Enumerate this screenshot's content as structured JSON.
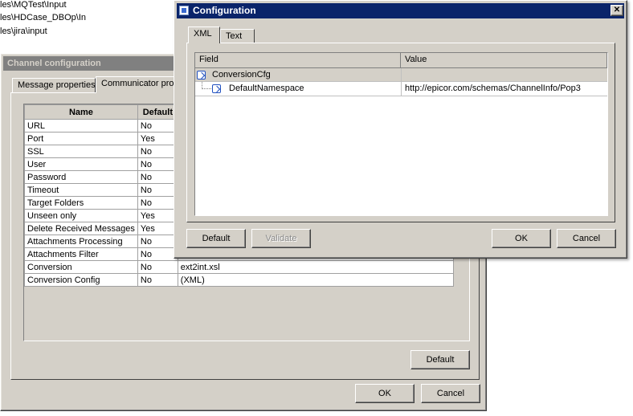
{
  "background_paths": [
    "les\\MQTest\\Input",
    "les\\HDCase_DBOp\\In",
    "les\\jira\\input"
  ],
  "channel_window": {
    "title": "Channel configuration",
    "tabs": [
      "Message properties",
      "Communicator prop"
    ],
    "columns": {
      "name": "Name",
      "default": "Default"
    },
    "rows": [
      {
        "name": "URL",
        "default": "No",
        "value": ""
      },
      {
        "name": "Port",
        "default": "Yes",
        "value": ""
      },
      {
        "name": "SSL",
        "default": "No",
        "value": ""
      },
      {
        "name": "User",
        "default": "No",
        "value": ""
      },
      {
        "name": "Password",
        "default": "No",
        "value": ""
      },
      {
        "name": "Timeout",
        "default": "No",
        "value": ""
      },
      {
        "name": "Target Folders",
        "default": "No",
        "value": ""
      },
      {
        "name": "Unseen only",
        "default": "Yes",
        "value": ""
      },
      {
        "name": "Delete Received Messages",
        "default": "Yes",
        "value": ""
      },
      {
        "name": "Attachments Processing",
        "default": "No",
        "value": ""
      },
      {
        "name": "Attachments Filter",
        "default": "No",
        "value": ""
      },
      {
        "name": "Conversion",
        "default": "No",
        "value": "ext2int.xsl"
      },
      {
        "name": "Conversion Config",
        "default": "No",
        "value": "(XML)"
      }
    ],
    "default_button": "Default",
    "ok_button": "OK",
    "cancel_button": "Cancel"
  },
  "config_dialog": {
    "title": "Configuration",
    "close_glyph": "✕",
    "tabs": [
      "XML",
      "Text"
    ],
    "columns": {
      "field": "Field",
      "value": "Value"
    },
    "tree": [
      {
        "field": "ConversionCfg",
        "value": ""
      },
      {
        "field": "DefaultNamespace",
        "value": "http://epicor.com/schemas/ChannelInfo/Pop3"
      }
    ],
    "default_button": "Default",
    "validate_button": "Validate",
    "ok_button": "OK",
    "cancel_button": "Cancel"
  },
  "colors": {
    "title_active": "#0a246a",
    "title_inactive": "#808080",
    "face": "#d4d0c8"
  }
}
